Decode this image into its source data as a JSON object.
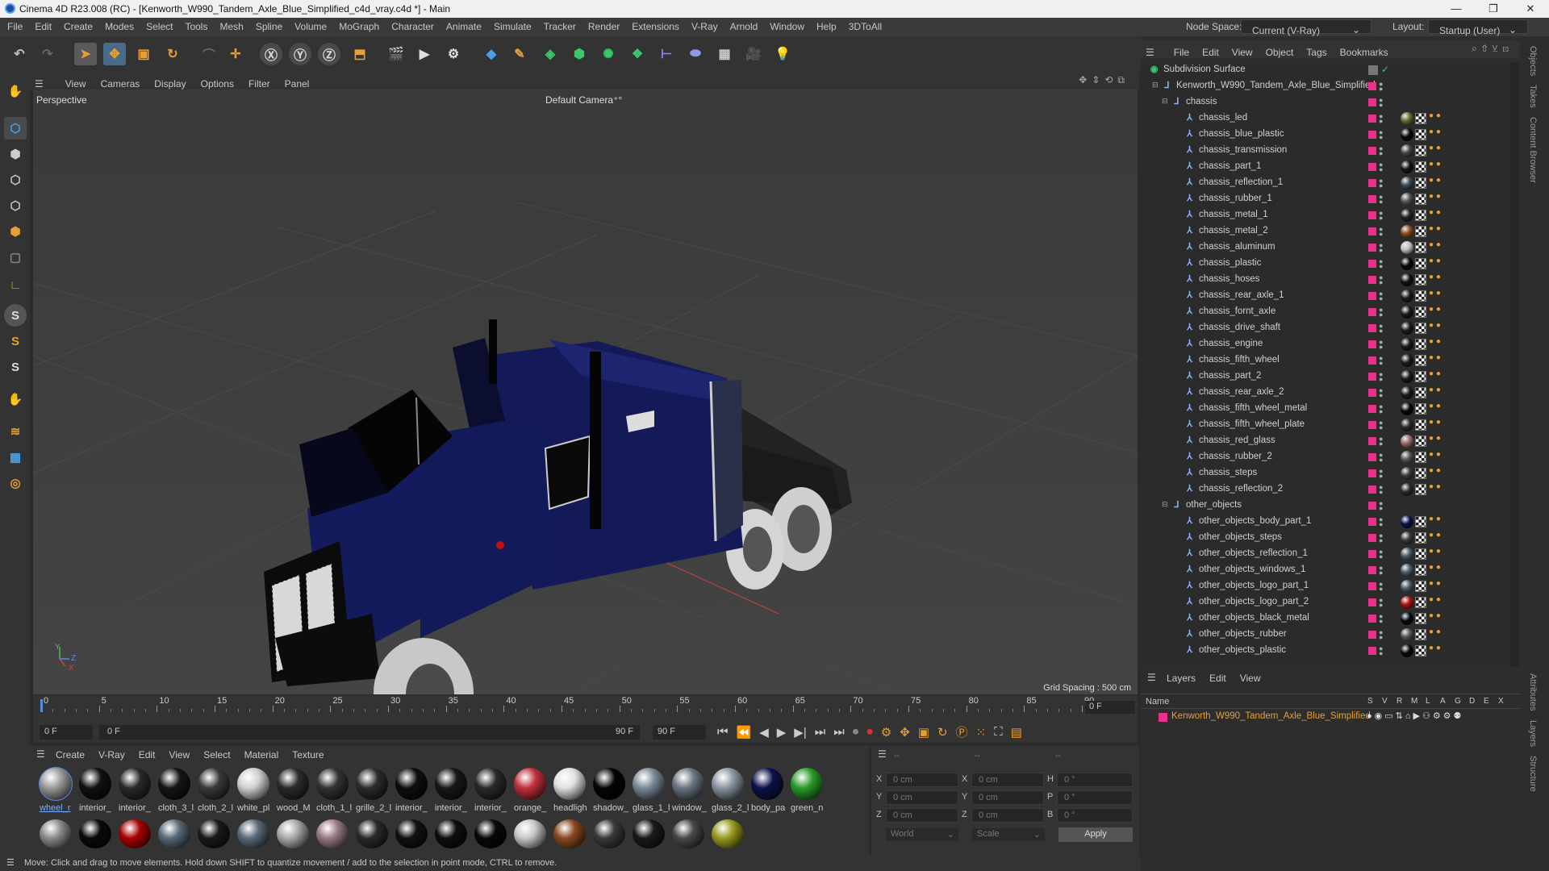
{
  "window": {
    "title": "Cinema 4D R23.008 (RC) - [Kenworth_W990_Tandem_Axle_Blue_Simplified_c4d_vray.c4d *] - Main",
    "minimize": "—",
    "maximize": "❐",
    "close": "✕"
  },
  "menubar": {
    "items": [
      "File",
      "Edit",
      "Create",
      "Modes",
      "Select",
      "Tools",
      "Mesh",
      "Spline",
      "Volume",
      "MoGraph",
      "Character",
      "Animate",
      "Simulate",
      "Tracker",
      "Render",
      "Extensions",
      "V-Ray",
      "Arnold",
      "Window",
      "Help",
      "3DToAll"
    ],
    "node_space_label": "Node Space:",
    "node_space_value": "Current (V-Ray)",
    "layout_label": "Layout:",
    "layout_value": "Startup (User)"
  },
  "viewport": {
    "menu": [
      "View",
      "Cameras",
      "Display",
      "Options",
      "Filter",
      "Panel"
    ],
    "name": "Perspective",
    "camera": "Default Camera",
    "grid_spacing": "Grid Spacing : 500 cm",
    "axis_y": "Y",
    "axis_z": "Z",
    "axis_x": "X"
  },
  "timeline": {
    "ticks": [
      "0",
      "5",
      "10",
      "15",
      "20",
      "25",
      "30",
      "35",
      "40",
      "45",
      "50",
      "55",
      "60",
      "65",
      "70",
      "75",
      "80",
      "85",
      "90"
    ],
    "end_frame": "0 F",
    "current_frame": "0 F",
    "range_start": "0 F",
    "range_end": "90 F",
    "max_frame": "90 F"
  },
  "materials": {
    "menu": [
      "Create",
      "V-Ray",
      "Edit",
      "View",
      "Select",
      "Material",
      "Texture"
    ],
    "row1": [
      {
        "name": "wheel_r",
        "color": "#9a9a9a"
      },
      {
        "name": "interior_",
        "color": "#111111"
      },
      {
        "name": "interior_",
        "color": "#2a2a2a"
      },
      {
        "name": "cloth_3_l",
        "color": "#151515"
      },
      {
        "name": "cloth_2_l",
        "color": "#3a3a3a"
      },
      {
        "name": "white_pl",
        "color": "#cfcfcf"
      },
      {
        "name": "wood_M",
        "color": "#2b2b2b"
      },
      {
        "name": "cloth_1_l",
        "color": "#333333"
      },
      {
        "name": "grille_2_l",
        "color": "#2c2c2c"
      },
      {
        "name": "interior_",
        "color": "#0e0e0e"
      },
      {
        "name": "interior_",
        "color": "#181818"
      },
      {
        "name": "interior_",
        "color": "#2a2a2a"
      },
      {
        "name": "orange_",
        "color": "#c0303a"
      },
      {
        "name": "headligh",
        "color": "#e0e0e0"
      },
      {
        "name": "shadow_",
        "color": "#050505"
      },
      {
        "name": "glass_1_l",
        "color": "#7a8a98"
      },
      {
        "name": "window_",
        "color": "#6a7682"
      },
      {
        "name": "glass_2_l",
        "color": "#8a96a2"
      },
      {
        "name": "body_pa",
        "color": "#0c1248"
      },
      {
        "name": "green_n",
        "color": "#2a9a2a"
      }
    ],
    "row2": [
      {
        "color": "#8a8a8a"
      },
      {
        "color": "#0a0a0a"
      },
      {
        "color": "#a80000"
      },
      {
        "color": "#5a6a78"
      },
      {
        "color": "#1a1a1a"
      },
      {
        "color": "#5a6a78"
      },
      {
        "color": "#aaaaaa"
      },
      {
        "color": "#9a7a88"
      },
      {
        "color": "#2a2a2a"
      },
      {
        "color": "#111111"
      },
      {
        "color": "#0e0e0e"
      },
      {
        "color": "#080808"
      },
      {
        "color": "#c8c8c8"
      },
      {
        "color": "#8a4a20"
      },
      {
        "color": "#3a3a3a"
      },
      {
        "color": "#1a1a1a"
      },
      {
        "color": "#4a4a4a"
      },
      {
        "color": "#9a9a20"
      }
    ]
  },
  "coords": {
    "header": [
      "--",
      "--",
      "--"
    ],
    "rows": [
      {
        "a": "X",
        "av": "0 cm",
        "b": "X",
        "bv": "0 cm",
        "c": "H",
        "cv": "0 °"
      },
      {
        "a": "Y",
        "av": "0 cm",
        "b": "Y",
        "bv": "0 cm",
        "c": "P",
        "cv": "0 °"
      },
      {
        "a": "Z",
        "av": "0 cm",
        "b": "Z",
        "bv": "0 cm",
        "c": "B",
        "cv": "0 °"
      }
    ],
    "space": "World",
    "mode": "Scale",
    "apply": "Apply"
  },
  "status": "Move: Click and drag to move elements. Hold down SHIFT to quantize movement / add to the selection in point mode, CTRL to remove.",
  "objects": {
    "menu": [
      "File",
      "Edit",
      "View",
      "Object",
      "Tags",
      "Bookmarks"
    ],
    "root": "Subdivision Surface",
    "model": "Kenworth_W990_Tandem_Axle_Blue_Simplified",
    "groups": [
      {
        "name": "chassis",
        "children": [
          {
            "name": "chassis_led",
            "mat": "#6a6a30"
          },
          {
            "name": "chassis_blue_plastic",
            "mat": "#0a0a0a"
          },
          {
            "name": "chassis_transmission",
            "mat": "#444"
          },
          {
            "name": "chassis_part_1",
            "mat": "#151515"
          },
          {
            "name": "chassis_reflection_1",
            "mat": "#3a4a56"
          },
          {
            "name": "chassis_rubber_1",
            "mat": "#555"
          },
          {
            "name": "chassis_metal_1",
            "mat": "#222"
          },
          {
            "name": "chassis_metal_2",
            "mat": "#8a4a20"
          },
          {
            "name": "chassis_aluminum",
            "mat": "#bbb"
          },
          {
            "name": "chassis_plastic",
            "mat": "#0a0a0a"
          },
          {
            "name": "chassis_hoses",
            "mat": "#111"
          },
          {
            "name": "chassis_rear_axle_1",
            "mat": "#1a1a1a"
          },
          {
            "name": "chassis_fornt_axle",
            "mat": "#1a1a1a"
          },
          {
            "name": "chassis_drive_shaft",
            "mat": "#1a1a1a"
          },
          {
            "name": "chassis_engine",
            "mat": "#1a1a1a"
          },
          {
            "name": "chassis_fifth_wheel",
            "mat": "#1a1a1a"
          },
          {
            "name": "chassis_part_2",
            "mat": "#1a1a1a"
          },
          {
            "name": "chassis_rear_axle_2",
            "mat": "#1a1a1a"
          },
          {
            "name": "chassis_fifth_wheel_metal",
            "mat": "#0a0a0a"
          },
          {
            "name": "chassis_fifth_wheel_plate",
            "mat": "#2a2a2a"
          },
          {
            "name": "chassis_red_glass",
            "mat": "#9a6a6a"
          },
          {
            "name": "chassis_rubber_2",
            "mat": "#555"
          },
          {
            "name": "chassis_steps",
            "mat": "#3a3a3a"
          },
          {
            "name": "chassis_reflection_2",
            "mat": "#2a2a2a"
          }
        ]
      },
      {
        "name": "other_objects",
        "children": [
          {
            "name": "other_objects_body_part_1",
            "mat": "#0c1248"
          },
          {
            "name": "other_objects_steps",
            "mat": "#3a3a3a"
          },
          {
            "name": "other_objects_reflection_1",
            "mat": "#4a5a66"
          },
          {
            "name": "other_objects_windows_1",
            "mat": "#4a5a66"
          },
          {
            "name": "other_objects_logo_part_1",
            "mat": "#4a5a66"
          },
          {
            "name": "other_objects_logo_part_2",
            "mat": "#b01010"
          },
          {
            "name": "other_objects_black_metal",
            "mat": "#0a0a0a"
          },
          {
            "name": "other_objects_rubber",
            "mat": "#555"
          },
          {
            "name": "other_objects_plastic",
            "mat": "#0a0a0a"
          }
        ]
      }
    ]
  },
  "layers": {
    "menu": [
      "Layers",
      "Edit",
      "View"
    ],
    "name_header": "Name",
    "cols": [
      "S",
      "V",
      "R",
      "M",
      "L",
      "A",
      "G",
      "D",
      "E",
      "X"
    ],
    "layer_name": "Kenworth_W990_Tandem_Axle_Blue_Simplified",
    "layer_color": "#e8318c"
  },
  "right_tabs": [
    "Objects",
    "Takes",
    "Content Browser",
    "Attributes",
    "Layers",
    "Structure"
  ]
}
